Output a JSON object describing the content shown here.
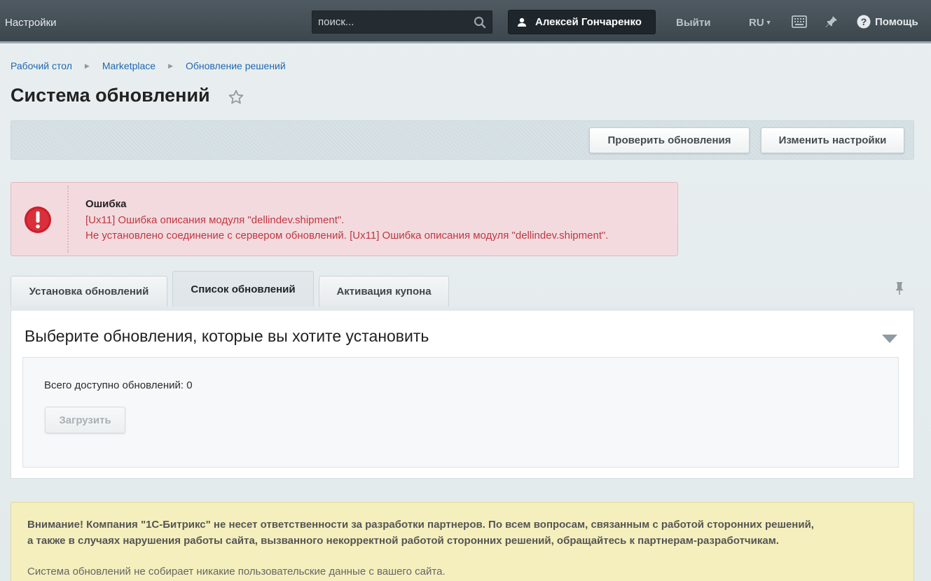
{
  "topbar": {
    "title": "Настройки",
    "search_placeholder": "поиск...",
    "user_name": "Алексей Гончаренко",
    "logout_label": "Выйти",
    "language": "RU",
    "help_label": "Помощь"
  },
  "breadcrumb": {
    "items": [
      "Рабочий стол",
      "Marketplace",
      "Обновление решений"
    ]
  },
  "page": {
    "title": "Система обновлений"
  },
  "toolbar": {
    "check_label": "Проверить обновления",
    "settings_label": "Изменить настройки"
  },
  "error": {
    "title": "Ошибка",
    "line1": "[Ux11] Ошибка описания модуля \"dellindev.shipment\".",
    "line2": "Не установлено соединение с сервером обновлений. [Ux11] Ошибка описания модуля \"dellindev.shipment\"."
  },
  "tabs": [
    {
      "label": "Установка обновлений"
    },
    {
      "label": "Список обновлений"
    },
    {
      "label": "Активация купона"
    }
  ],
  "panel": {
    "title": "Выберите обновления, которые вы хотите установить",
    "count_text": "Всего доступно обновлений: 0",
    "load_label": "Загрузить"
  },
  "warning": {
    "line1": "Внимание! Компания \"1С-Битрикс\" не несет ответственности за разработки партнеров. По всем вопросам, связанным с работой сторонних решений,",
    "line2": "а также в случаях нарушения работы сайта, вызванного некорректной работой сторонних решений, обращайтесь к партнерам-разработчикам.",
    "line3": "Система обновлений не собирает никакие пользовательские данные с вашего сайта."
  },
  "colors": {
    "topbar": "#3c464d",
    "link": "#2067b0",
    "error_text": "#c0373f",
    "error_bg": "#f3dadf",
    "warning_bg": "#f5efbd"
  }
}
